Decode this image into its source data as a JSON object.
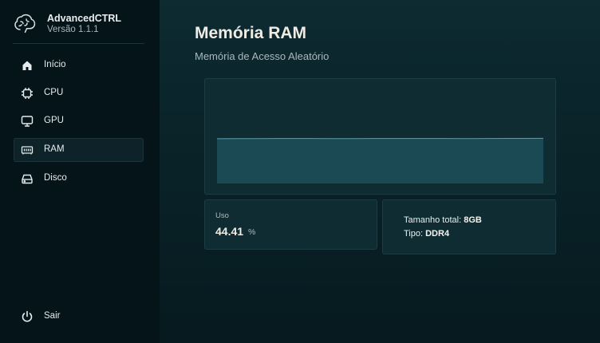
{
  "app": {
    "name": "AdvancedCTRL",
    "version": "Versão 1.1.1"
  },
  "sidebar": {
    "items": [
      {
        "label": "Início",
        "icon": "home-icon"
      },
      {
        "label": "CPU",
        "icon": "cpu-icon"
      },
      {
        "label": "GPU",
        "icon": "monitor-icon"
      },
      {
        "label": "RAM",
        "icon": "memory-icon",
        "active": true
      },
      {
        "label": "Disco",
        "icon": "disk-icon"
      }
    ],
    "logout": {
      "label": "Sair",
      "icon": "power-icon"
    }
  },
  "page": {
    "title": "Memória RAM",
    "subtitle": "Memória de Acesso Aleatório"
  },
  "usage": {
    "label": "Uso",
    "value": "44.41",
    "unit": "%"
  },
  "info": {
    "total_label": "Tamanho total:",
    "total_value": "8GB",
    "type_label": "Tipo:",
    "type_value": "DDR4"
  },
  "colors": {
    "accent": "#3fa7bd",
    "area_fill": "#1c4a54",
    "card_bg": "#0f2c33"
  },
  "chart_data": {
    "type": "area",
    "series": [
      {
        "values": [
          44.2,
          44.3,
          44.3,
          44.4,
          44.4,
          44.4,
          44.3,
          44.3,
          44.4,
          44.4,
          44.4,
          44.4,
          44.4,
          44.3,
          44.4,
          44.5,
          44.5,
          44.6
        ]
      }
    ],
    "ylim": [
      0,
      100
    ],
    "grid": false
  }
}
